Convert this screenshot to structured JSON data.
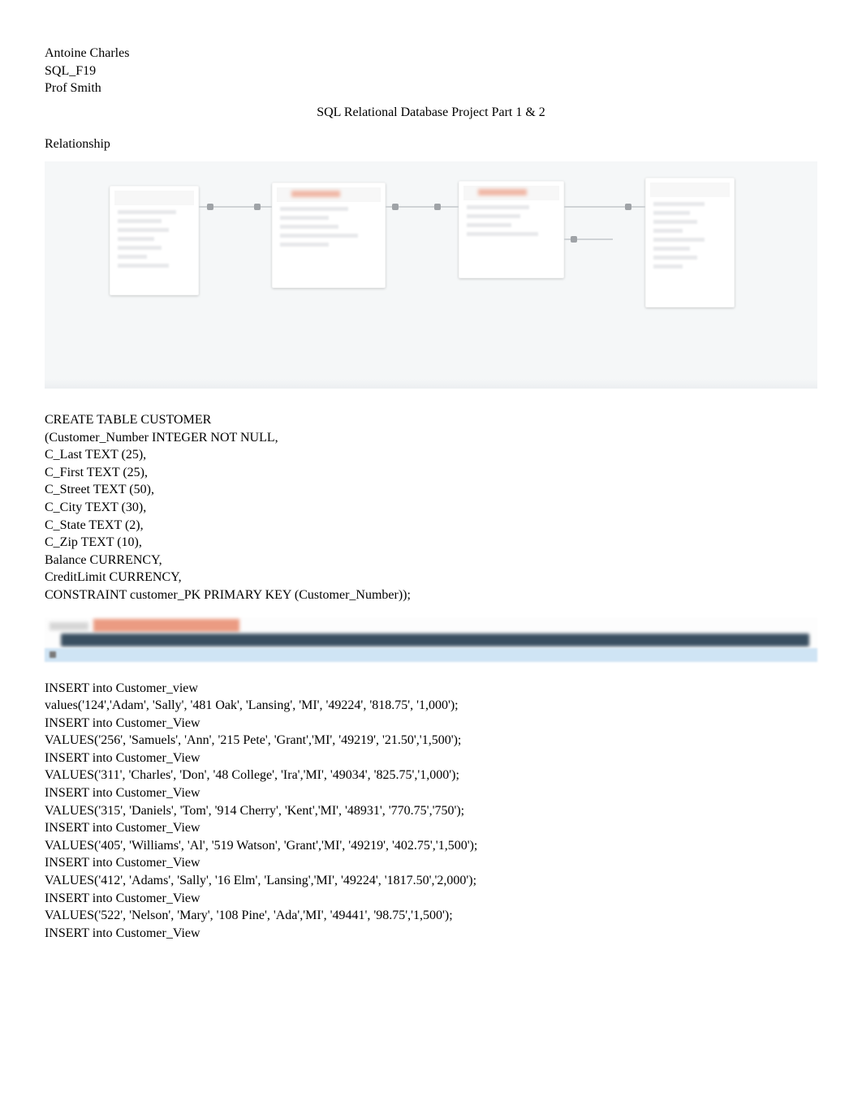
{
  "header": {
    "line1": "Antoine Charles",
    "line2": "SQL_F19",
    "line3": "Prof Smith"
  },
  "title": "SQL Relational Database Project Part 1 & 2",
  "section_relationship": "Relationship",
  "sql_create": [
    "CREATE TABLE CUSTOMER",
    "(Customer_Number INTEGER NOT NULL,",
    "C_Last TEXT (25),",
    "C_First TEXT (25),",
    "C_Street TEXT (50),",
    "C_City TEXT (30),",
    "C_State TEXT (2),",
    "C_Zip TEXT (10),",
    "Balance CURRENCY,",
    "CreditLimit CURRENCY,",
    "CONSTRAINT customer_PK PRIMARY KEY (Customer_Number));"
  ],
  "inserts": [
    "INSERT into Customer_view",
    "values('124','Adam', 'Sally', '481 Oak', 'Lansing', 'MI', '49224', '818.75', '1,000');",
    "INSERT into Customer_View",
    "VALUES('256', 'Samuels', 'Ann', '215 Pete', 'Grant','MI', '49219', '21.50','1,500');",
    "INSERT into Customer_View",
    "VALUES('311', 'Charles', 'Don', '48 College', 'Ira','MI', '49034', '825.75','1,000');",
    "INSERT into Customer_View",
    "VALUES('315', 'Daniels', 'Tom', '914 Cherry', 'Kent','MI', '48931', '770.75','750');",
    "INSERT into Customer_View",
    "VALUES('405', 'Williams', 'Al', '519 Watson', 'Grant','MI', '49219', '402.75','1,500');",
    "INSERT into Customer_View",
    "VALUES('412', 'Adams', 'Sally', '16 Elm', 'Lansing','MI', '49224', '1817.50','2,000');",
    "INSERT into Customer_View",
    "VALUES('522', 'Nelson', 'Mary', '108 Pine', 'Ada','MI', '49441', '98.75','1,500');",
    "INSERT into Customer_View"
  ]
}
